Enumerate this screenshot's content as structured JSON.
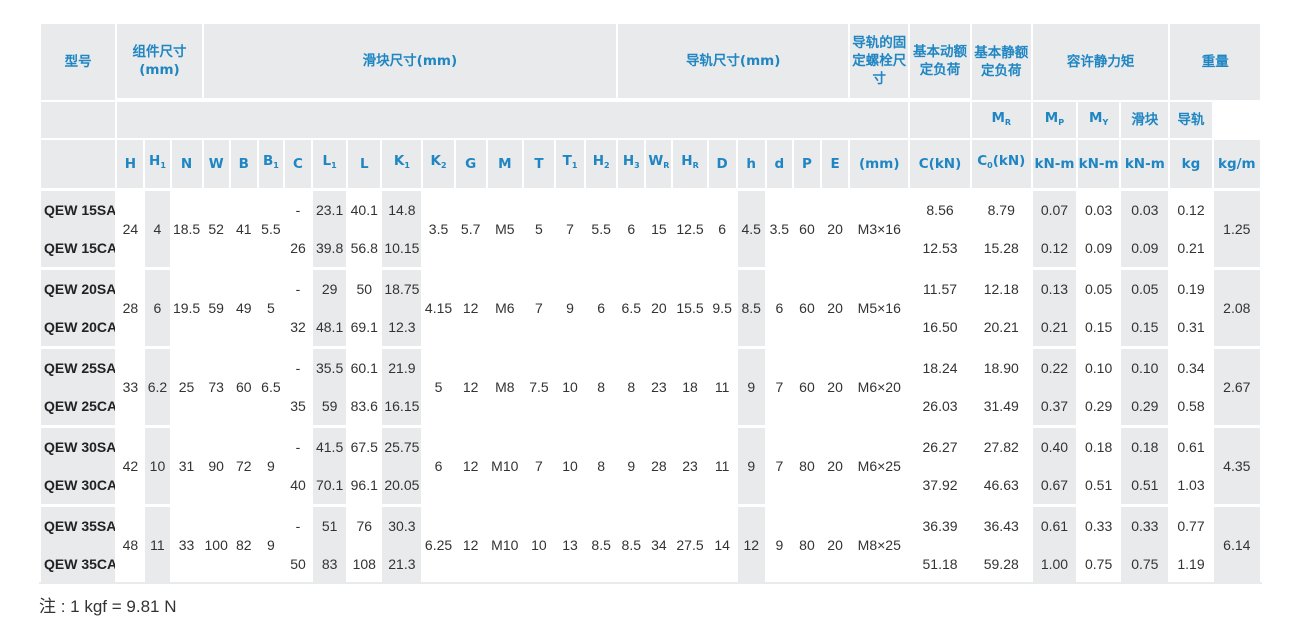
{
  "header": {
    "model": "型号",
    "assembly_dims": "组件尺寸(mm)",
    "block_dims": "滑块尺寸(mm)",
    "rail_dims": "导轨尺寸(mm)",
    "rail_bolt": "导轨的固定螺栓尺寸",
    "dyn_load": "基本动额定负荷",
    "static_load": "基本静额定负荷",
    "static_moment": "容许静力矩",
    "weight": "重量",
    "weight_block": "滑块",
    "weight_rail": "导轨",
    "bolt_unit": "(mm)",
    "c_unit": "C(kN)",
    "c0_unit": "(kN)",
    "moment_unit": "kN-m",
    "kg": "kg",
    "kgm": "kg/m"
  },
  "columns": {
    "H": "H",
    "H1": "H",
    "N": "N",
    "W": "W",
    "B": "B",
    "B1": "B",
    "C": "C",
    "L1": "L",
    "L": "L",
    "K1": "K",
    "K2": "K",
    "G": "G",
    "M": "M",
    "T": "T",
    "T1": "T",
    "H2": "H",
    "H3": "H",
    "WR": "W",
    "HR": "H",
    "D": "D",
    "h": "h",
    "d": "d",
    "P": "P",
    "E": "E",
    "C0": "C",
    "MR": "M",
    "MP": "M",
    "MY": "M"
  },
  "subscripts": {
    "H1": "1",
    "B1": "1",
    "L1": "1",
    "K1": "1",
    "K2": "2",
    "T1": "1",
    "H2": "2",
    "H3": "3",
    "WR": "R",
    "HR": "R",
    "C0": "0",
    "MR": "R",
    "MP": "P",
    "MY": "Y"
  },
  "rows": [
    {
      "sa": {
        "model": "QEW 15SA",
        "C": "-",
        "L1": "23.1",
        "L": "40.1",
        "K1": "14.8",
        "Cdyn": "8.56",
        "C0": "8.79",
        "MR": "0.07",
        "MP": "0.03",
        "MY": "0.03",
        "wb": "0.12"
      },
      "ca": {
        "model": "QEW 15CA",
        "C": "26",
        "L1": "39.8",
        "L": "56.8",
        "K1": "10.15",
        "Cdyn": "12.53",
        "C0": "15.28",
        "MR": "0.12",
        "MP": "0.09",
        "MY": "0.09",
        "wb": "0.21"
      },
      "H": "24",
      "H1": "4",
      "N": "18.5",
      "W": "52",
      "B": "41",
      "B1": "5.5",
      "K2": "3.5",
      "G": "5.7",
      "M": "M5",
      "T": "5",
      "T1": "7",
      "H2": "5.5",
      "H3": "6",
      "WR": "15",
      "HR": "12.5",
      "D": "6",
      "h": "4.5",
      "d": "3.5",
      "P": "60",
      "E": "20",
      "bolt": "M3×16",
      "wr": "1.25"
    },
    {
      "sa": {
        "model": "QEW 20SA",
        "C": "-",
        "L1": "29",
        "L": "50",
        "K1": "18.75",
        "Cdyn": "11.57",
        "C0": "12.18",
        "MR": "0.13",
        "MP": "0.05",
        "MY": "0.05",
        "wb": "0.19"
      },
      "ca": {
        "model": "QEW 20CA",
        "C": "32",
        "L1": "48.1",
        "L": "69.1",
        "K1": "12.3",
        "Cdyn": "16.50",
        "C0": "20.21",
        "MR": "0.21",
        "MP": "0.15",
        "MY": "0.15",
        "wb": "0.31"
      },
      "H": "28",
      "H1": "6",
      "N": "19.5",
      "W": "59",
      "B": "49",
      "B1": "5",
      "K2": "4.15",
      "G": "12",
      "M": "M6",
      "T": "7",
      "T1": "9",
      "H2": "6",
      "H3": "6.5",
      "WR": "20",
      "HR": "15.5",
      "D": "9.5",
      "h": "8.5",
      "d": "6",
      "P": "60",
      "E": "20",
      "bolt": "M5×16",
      "wr": "2.08"
    },
    {
      "sa": {
        "model": "QEW 25SA",
        "C": "-",
        "L1": "35.5",
        "L": "60.1",
        "K1": "21.9",
        "Cdyn": "18.24",
        "C0": "18.90",
        "MR": "0.22",
        "MP": "0.10",
        "MY": "0.10",
        "wb": "0.34"
      },
      "ca": {
        "model": "QEW 25CA",
        "C": "35",
        "L1": "59",
        "L": "83.6",
        "K1": "16.15",
        "Cdyn": "26.03",
        "C0": "31.49",
        "MR": "0.37",
        "MP": "0.29",
        "MY": "0.29",
        "wb": "0.58"
      },
      "H": "33",
      "H1": "6.2",
      "N": "25",
      "W": "73",
      "B": "60",
      "B1": "6.5",
      "K2": "5",
      "G": "12",
      "M": "M8",
      "T": "7.5",
      "T1": "10",
      "H2": "8",
      "H3": "8",
      "WR": "23",
      "HR": "18",
      "D": "11",
      "h": "9",
      "d": "7",
      "P": "60",
      "E": "20",
      "bolt": "M6×20",
      "wr": "2.67"
    },
    {
      "sa": {
        "model": "QEW 30SA",
        "C": "-",
        "L1": "41.5",
        "L": "67.5",
        "K1": "25.75",
        "Cdyn": "26.27",
        "C0": "27.82",
        "MR": "0.40",
        "MP": "0.18",
        "MY": "0.18",
        "wb": "0.61"
      },
      "ca": {
        "model": "QEW 30CA",
        "C": "40",
        "L1": "70.1",
        "L": "96.1",
        "K1": "20.05",
        "Cdyn": "37.92",
        "C0": "46.63",
        "MR": "0.67",
        "MP": "0.51",
        "MY": "0.51",
        "wb": "1.03"
      },
      "H": "42",
      "H1": "10",
      "N": "31",
      "W": "90",
      "B": "72",
      "B1": "9",
      "K2": "6",
      "G": "12",
      "M": "M10",
      "T": "7",
      "T1": "10",
      "H2": "8",
      "H3": "9",
      "WR": "28",
      "HR": "23",
      "D": "11",
      "h": "9",
      "d": "7",
      "P": "80",
      "E": "20",
      "bolt": "M6×25",
      "wr": "4.35"
    },
    {
      "sa": {
        "model": "QEW 35SA",
        "C": "-",
        "L1": "51",
        "L": "76",
        "K1": "30.3",
        "Cdyn": "36.39",
        "C0": "36.43",
        "MR": "0.61",
        "MP": "0.33",
        "MY": "0.33",
        "wb": "0.77"
      },
      "ca": {
        "model": "QEW 35CA",
        "C": "50",
        "L1": "83",
        "L": "108",
        "K1": "21.3",
        "Cdyn": "51.18",
        "C0": "59.28",
        "MR": "1.00",
        "MP": "0.75",
        "MY": "0.75",
        "wb": "1.19"
      },
      "H": "48",
      "H1": "11",
      "N": "33",
      "W": "100",
      "B": "82",
      "B1": "9",
      "K2": "6.25",
      "G": "12",
      "M": "M10",
      "T": "10",
      "T1": "13",
      "H2": "8.5",
      "H3": "8.5",
      "WR": "34",
      "HR": "27.5",
      "D": "14",
      "h": "12",
      "d": "9",
      "P": "80",
      "E": "20",
      "bolt": "M8×25",
      "wr": "6.14"
    }
  ],
  "note": "注 : 1 kgf = 9.81 N",
  "colors": {
    "header_text": "#1f86c3",
    "shade": "#e8eaeb",
    "body_text": "#333333"
  }
}
